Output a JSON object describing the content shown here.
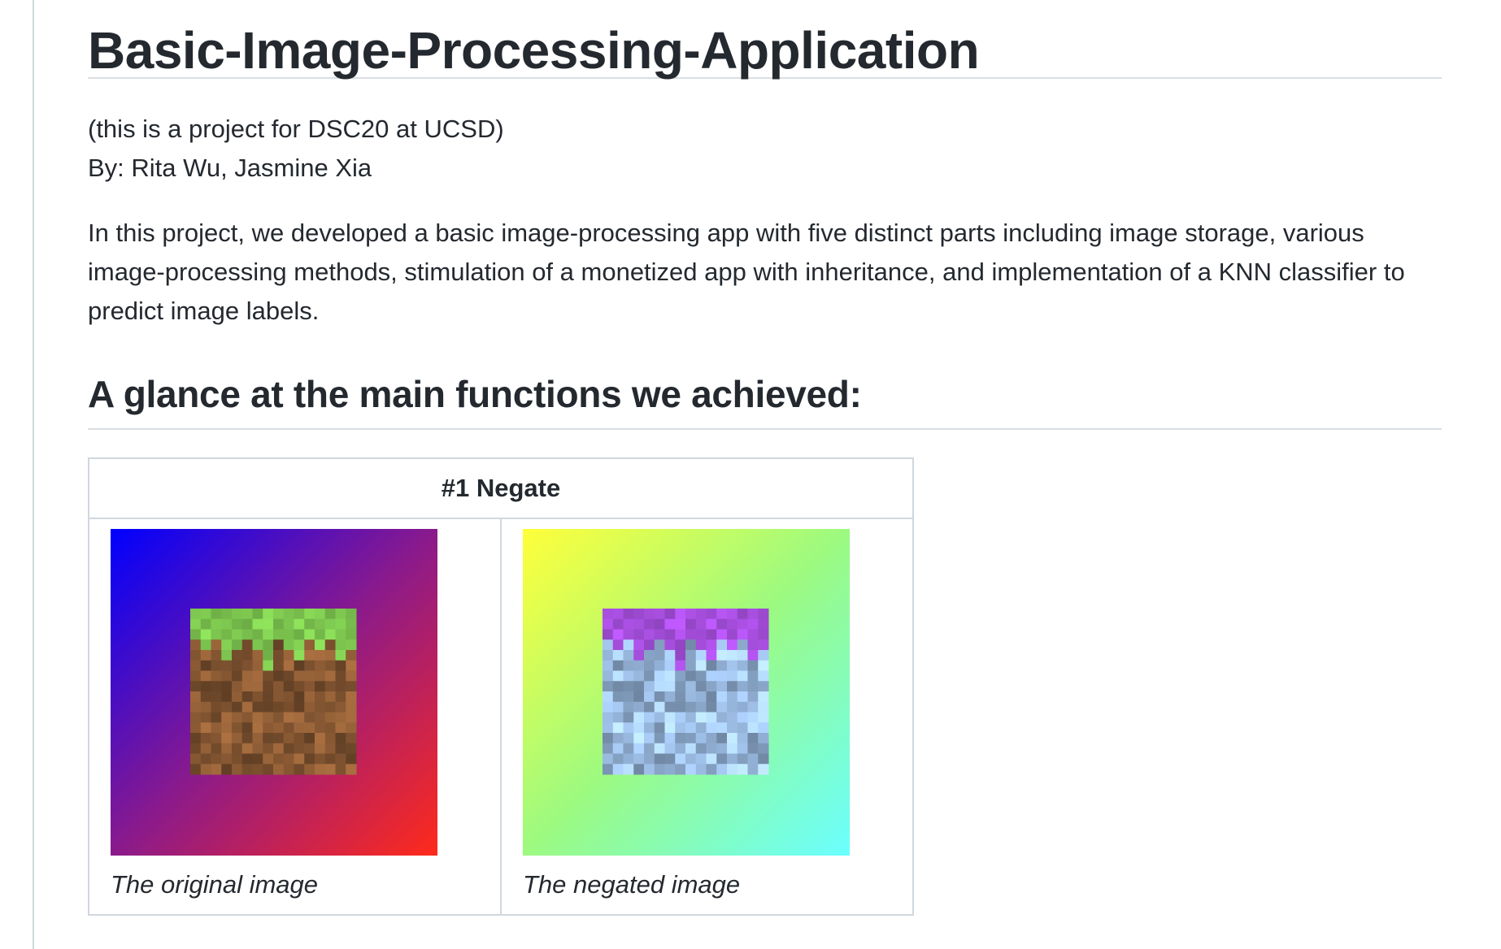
{
  "title": "Basic-Image-Processing-Application",
  "meta": {
    "line1": "(this is a project for DSC20 at UCSD)",
    "line2": "By: Rita Wu, Jasmine Xia"
  },
  "intro": "In this project, we developed a basic image-processing app with five distinct parts including image storage, various image-processing methods, stimulation of a monetized app with inheritance, and implementation of a KNN classifier to predict image labels.",
  "section_heading": "A glance at the main functions we achieved:",
  "demo_table": {
    "header": "#1 Negate",
    "cells": [
      {
        "caption": "The original image",
        "image": "grass-block-original"
      },
      {
        "caption": "The negated image",
        "image": "grass-block-negated"
      }
    ]
  },
  "colors": {
    "original_gradient": [
      "#0000ff",
      "#ff2a1a"
    ],
    "negated_gradient": [
      "#ffff00",
      "#6affff"
    ],
    "grass": "#7ec850",
    "dirt": "#8a5a34",
    "negated_grass": "#a84fe0",
    "negated_dirt": "#9fc0e8"
  }
}
